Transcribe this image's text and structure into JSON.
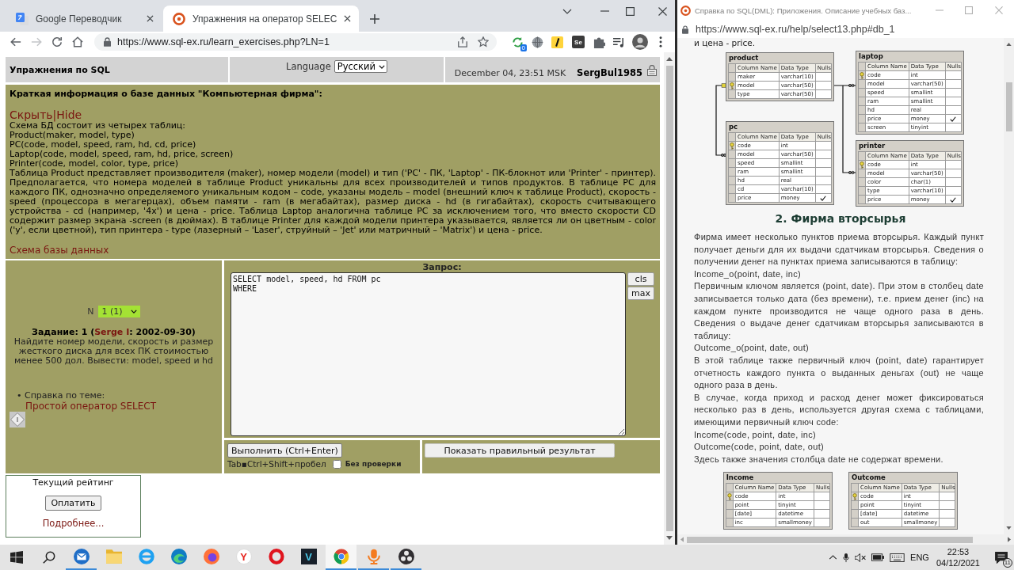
{
  "left_window": {
    "tabs": [
      {
        "kind": "translate",
        "title": "Google Переводчик",
        "selected": false
      },
      {
        "kind": "target",
        "title": "Упражнения на оператор SELEC",
        "selected": true
      }
    ],
    "forward_button": {
      "disabled": true
    },
    "address": "https://www.sql-ex.ru/learn_exercises.php?LN=1",
    "extension_badge": "0",
    "extension_label": "Se",
    "page": {
      "header": {
        "title": "Упражнения по SQL",
        "language_label": "Language",
        "language": "Русский",
        "datetime": "December 04, 23:51 MSK",
        "user": "SergBul1985"
      },
      "info": {
        "heading": "Краткая информация о базе данных \"Компьютерная фирма\":",
        "toggle": "Скрыть|Hide",
        "lines": [
          "Схема БД состоит из четырех таблиц:",
          "Product(maker, model, type)",
          "PC(code, model, speed, ram, hd, cd, price)",
          "Laptop(code, model, speed, ram, hd, price, screen)",
          "Printer(code, model, color, type, price)"
        ],
        "description": "Таблица Product представляет производителя (maker), номер модели (model) и тип ('PC' - ПК, 'Laptop' - ПК-блокнот или 'Printer' - принтер). Предполагается, что номера моделей в таблице Product уникальны для всех производителей и типов продуктов. В таблице PC для каждого ПК, однозначно определяемого уникальным кодом – code, указаны модель – model (внешний ключ к таблице Product), скорость - speed (процессора в мегагерцах), объем памяти - ram (в мегабайтах), размер диска - hd (в гигабайтах), скорость считывающего устройства - cd (например, '4x') и цена - price. Таблица Laptop аналогична таблице PC за исключением того, что вместо скорости CD содержит размер экрана -screen (в дюймах). В таблице Printer для каждой модели принтера указывается, является ли он цветным - color ('y', если цветной), тип принтера - type (лазерный – 'Laser', струйный – 'Jet' или матричный – 'Matrix') и цена - price.",
        "schema_link": "Схема базы данных"
      },
      "task": {
        "number_label": "N",
        "number": "1 (1)",
        "title_start": "Задание: 1 (",
        "author": "Serge I",
        "title_end": ": 2002-09-30)",
        "text": "Найдите номер модели, скорость и размер жесткого диска для всех ПК стоимостью менее 500 дол. Вывести: model, speed и hd"
      },
      "help": {
        "label": "• Справка по теме:",
        "link": "Простой оператор SELECT"
      },
      "query": {
        "label": "Запрос:",
        "value": "SELECT model, speed, hd FROM pc\nWHERE",
        "side_buttons": [
          "cls",
          "max"
        ]
      },
      "run_button": "Выполнить (Ctrl+Enter)",
      "hint": "Tab▪Ctrl+Shift+пробел",
      "no_check": {
        "label": "Без проверки",
        "checked": false
      },
      "result_button": "Показать правильный результат",
      "rating": {
        "title": "Текущий рейтинг",
        "button": "Оплатить",
        "link": "Подробнее..."
      }
    }
  },
  "help_window": {
    "title": "Справка по SQL(DML): Приложения. Описание учебных баз...",
    "address": "https://www.sql-ex.ru/help/select13.php#db_1",
    "top_line": "и цена - price.",
    "diagram_tables": [
      {
        "name": "product",
        "header": [
          "Column Name",
          "Data Type",
          "Nulls"
        ],
        "columns": [
          {
            "name": "maker",
            "type": "varchar(10)",
            "key": false,
            "nulls": false
          },
          {
            "name": "model",
            "type": "varchar(50)",
            "key": true,
            "nulls": false
          },
          {
            "name": "type",
            "type": "varchar(50)",
            "key": false,
            "nulls": false
          }
        ]
      },
      {
        "name": "laptop",
        "header": [
          "Column Name",
          "Data Type",
          "Nulls"
        ],
        "columns": [
          {
            "name": "code",
            "type": "int",
            "key": true,
            "nulls": false
          },
          {
            "name": "model",
            "type": "varchar(50)",
            "key": false,
            "nulls": false
          },
          {
            "name": "speed",
            "type": "smallint",
            "key": false,
            "nulls": false
          },
          {
            "name": "ram",
            "type": "smallint",
            "key": false,
            "nulls": false
          },
          {
            "name": "hd",
            "type": "real",
            "key": false,
            "nulls": false
          },
          {
            "name": "price",
            "type": "money",
            "key": false,
            "nulls": true
          },
          {
            "name": "screen",
            "type": "tinyint",
            "key": false,
            "nulls": false
          }
        ]
      },
      {
        "name": "pc",
        "header": [
          "Column Name",
          "Data Type",
          "Nulls"
        ],
        "columns": [
          {
            "name": "code",
            "type": "int",
            "key": true,
            "nulls": false
          },
          {
            "name": "model",
            "type": "varchar(50)",
            "key": false,
            "nulls": false
          },
          {
            "name": "speed",
            "type": "smallint",
            "key": false,
            "nulls": false
          },
          {
            "name": "ram",
            "type": "smallint",
            "key": false,
            "nulls": false
          },
          {
            "name": "hd",
            "type": "real",
            "key": false,
            "nulls": false
          },
          {
            "name": "cd",
            "type": "varchar(10)",
            "key": false,
            "nulls": false
          },
          {
            "name": "price",
            "type": "money",
            "key": false,
            "nulls": true
          }
        ]
      },
      {
        "name": "printer",
        "header": [
          "Column Name",
          "Data Type",
          "Nulls"
        ],
        "columns": [
          {
            "name": "code",
            "type": "int",
            "key": true,
            "nulls": false
          },
          {
            "name": "model",
            "type": "varchar(50)",
            "key": false,
            "nulls": false
          },
          {
            "name": "color",
            "type": "char(1)",
            "key": false,
            "nulls": false
          },
          {
            "name": "type",
            "type": "varchar(10)",
            "key": false,
            "nulls": false
          },
          {
            "name": "price",
            "type": "money",
            "key": false,
            "nulls": true
          }
        ]
      }
    ],
    "section_title": "2. Фирма вторсырья",
    "paragraphs": [
      "Фирма имеет несколько пунктов приема вторсырья. Каждый пункт получает деньги для их выдачи сдатчикам вторсырья. Сведения о получении денег на пунктах приема записываются в таблицу:",
      "Income_o(point, date, inc)",
      "Первичным ключом является (point, date). При этом в столбец date записывается только дата (без времени), т.е. прием денег (inc) на каждом пункте производится не чаще одного раза в день. Сведения о выдаче денег сдатчикам вторсырья записываются в таблицу:",
      "Outcome_o(point, date, out)",
      "В этой таблице также первичный ключ (point, date) гарантирует отчетность каждого пункта о выданных деньгах (out) не чаще одного раза в день.",
      "В случае, когда приход и расход денег может фиксироваться несколько раз в день, используется другая схема с таблицами, имеющими первичный ключ code:",
      "Income(code, point, date, inc)",
      "Outcome(code, point, date, out)",
      "Здесь также значения столбца date не содержат времени."
    ],
    "tables": [
      {
        "name": "Income",
        "header": [
          "Column Name",
          "Data Type",
          "Nulls"
        ],
        "columns": [
          {
            "name": "code",
            "type": "int",
            "key": true,
            "nulls": false
          },
          {
            "name": "point",
            "type": "tinyint",
            "key": false,
            "nulls": false
          },
          {
            "name": "[date]",
            "type": "datetime",
            "key": false,
            "nulls": false
          },
          {
            "name": "inc",
            "type": "smallmoney",
            "key": false,
            "nulls": false
          }
        ]
      },
      {
        "name": "Outcome",
        "header": [
          "Column Name",
          "Data Type",
          "Nulls"
        ],
        "columns": [
          {
            "name": "code",
            "type": "int",
            "key": true,
            "nulls": false
          },
          {
            "name": "point",
            "type": "tinyint",
            "key": false,
            "nulls": false
          },
          {
            "name": "[date]",
            "type": "datetime",
            "key": false,
            "nulls": false
          },
          {
            "name": "out",
            "type": "smallmoney",
            "key": false,
            "nulls": false
          }
        ]
      }
    ]
  },
  "taskbar": {
    "apps": [
      {
        "kind": "mail",
        "running": true,
        "active": false
      },
      {
        "kind": "folder",
        "running": false,
        "active": false
      },
      {
        "kind": "ringbar",
        "running": false,
        "active": false
      },
      {
        "kind": "swirl",
        "running": false,
        "active": false
      },
      {
        "kind": "orb",
        "running": false,
        "active": false
      },
      {
        "kind": "letter",
        "label": "Y",
        "running": false,
        "active": false
      },
      {
        "kind": "ring",
        "running": false,
        "active": false
      },
      {
        "kind": "tile",
        "label": "V",
        "running": false,
        "active": false
      },
      {
        "kind": "segments",
        "running": true,
        "active": true
      },
      {
        "kind": "microphone",
        "running": true,
        "active": false
      },
      {
        "kind": "dots",
        "running": true,
        "active": false
      }
    ],
    "language": "ENG",
    "time": "22:53",
    "date": "04/12/2021",
    "notifications": "11"
  }
}
